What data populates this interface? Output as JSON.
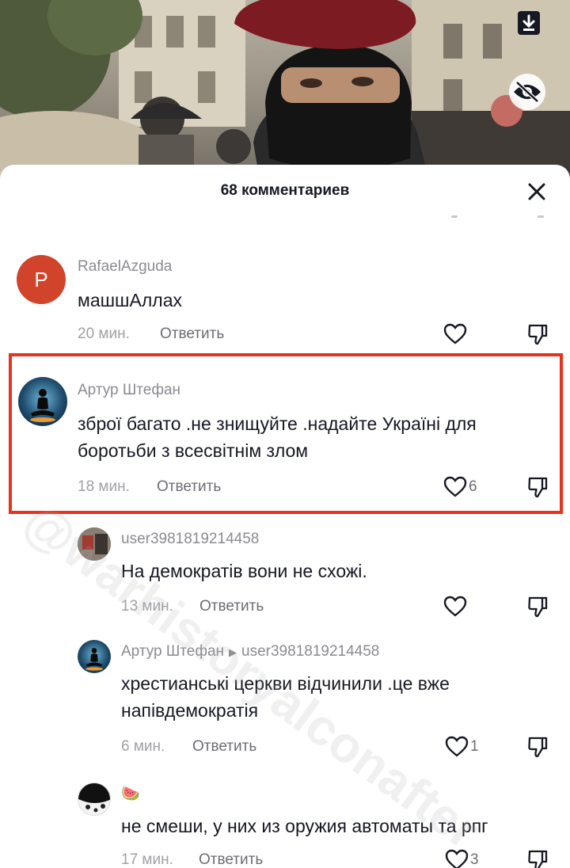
{
  "video": {
    "download_icon": "download-icon",
    "hide_icon": "eye-off-icon"
  },
  "sheet": {
    "title": "68 комментариев",
    "close_icon": "close-icon"
  },
  "watermark": "@warhistoryalconafter",
  "comments": [
    {
      "username": "RafaelAzguda",
      "avatar_letter": "P",
      "avatar_color": "#d2432c",
      "text_lines": [
        "машшАллах"
      ],
      "time": "20 мин.",
      "reply_label": "Ответить",
      "likes": ""
    },
    {
      "username": "Артур Штефан",
      "text_lines": [
        "зброї багато .не знищуйте .надайте Україні для",
        "боротьби з всесвітнім злом"
      ],
      "time": "18 мин.",
      "reply_label": "Ответить",
      "likes": "6"
    },
    {
      "username": "user3981819214458",
      "text_lines": [
        "На демократів вони не схожі."
      ],
      "time": "13 мин.",
      "reply_label": "Ответить",
      "likes": ""
    },
    {
      "username": "Артур Штефан",
      "reply_to": "user3981819214458",
      "text_lines": [
        "хрестианські церкви відчинили .це вже",
        "напівдемократія"
      ],
      "time": "6 мин.",
      "reply_label": "Ответить",
      "likes": "1"
    },
    {
      "username": "🍉",
      "text_lines": [
        "не смеши, у них из оружия автоматы та рпг"
      ],
      "time": "17 мин.",
      "reply_label": "Ответить",
      "likes": "3"
    }
  ],
  "colors": {
    "highlight": "#e8321c",
    "text": "#161823",
    "muted": "#8a8b91"
  }
}
